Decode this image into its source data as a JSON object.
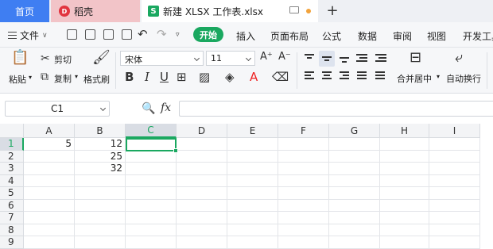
{
  "tabs": {
    "home": "首页",
    "daoke": "稻壳",
    "document": "新建 XLSX 工作表.xlsx"
  },
  "menu": {
    "file": "文件",
    "start": "开始",
    "items": [
      "插入",
      "页面布局",
      "公式",
      "数据",
      "审阅",
      "视图",
      "开发工具"
    ]
  },
  "ribbon": {
    "paste": "粘贴",
    "cut": "剪切",
    "copy": "复制",
    "format_painter": "格式刷",
    "font_name": "宋体",
    "font_size": "11",
    "merge_center": "合并居中",
    "wrap_text": "自动换行"
  },
  "formula_bar": {
    "name_box": "C1",
    "fx": "fx",
    "value": ""
  },
  "grid": {
    "columns": [
      "A",
      "B",
      "C",
      "D",
      "E",
      "F",
      "G",
      "H",
      "I"
    ],
    "rows": [
      "1",
      "2",
      "3",
      "4",
      "5",
      "6",
      "7",
      "8",
      "9"
    ],
    "active_cell": "C1",
    "cells": {
      "A1": "5",
      "B1": "12",
      "B2": "25",
      "B3": "32"
    }
  },
  "colors": {
    "accent_green": "#1aa860",
    "home_tab_blue": "#3f7ef2",
    "daoke_tab_pink": "#f2c4c8"
  }
}
